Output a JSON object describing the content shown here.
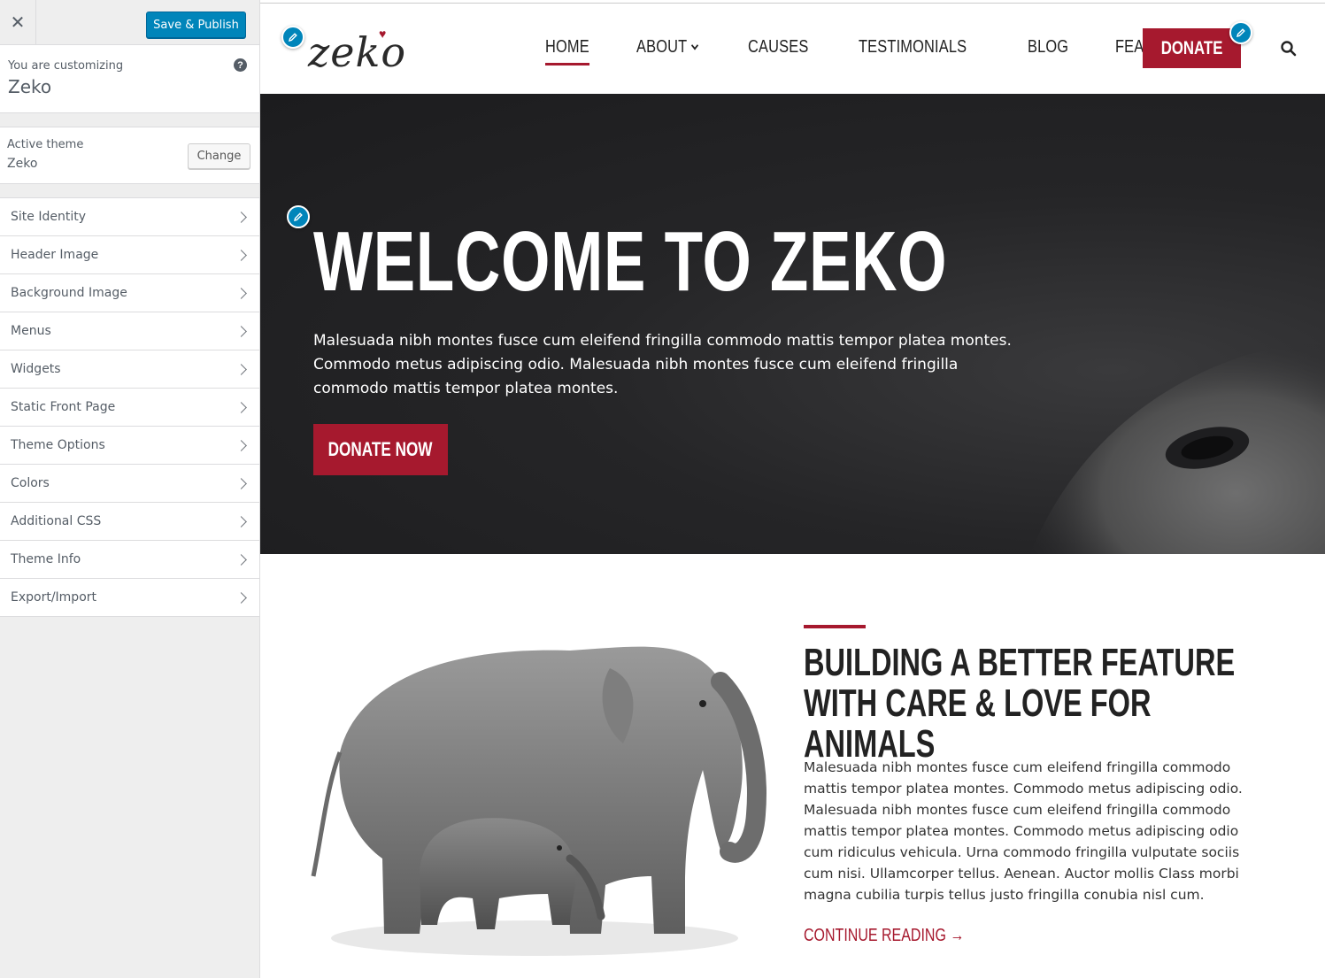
{
  "customizer": {
    "close_icon": "close-icon",
    "save_publish": "Save & Publish",
    "customizing_label": "You are customizing",
    "site_name": "Zeko",
    "help_icon": "?",
    "active_theme_label": "Active theme",
    "active_theme_name": "Zeko",
    "change_label": "Change",
    "items": [
      {
        "label": "Site Identity"
      },
      {
        "label": "Header Image"
      },
      {
        "label": "Background Image"
      },
      {
        "label": "Menus"
      },
      {
        "label": "Widgets"
      },
      {
        "label": "Static Front Page"
      },
      {
        "label": "Theme Options"
      },
      {
        "label": "Colors"
      },
      {
        "label": "Additional CSS"
      },
      {
        "label": "Theme Info"
      },
      {
        "label": "Export/Import"
      }
    ]
  },
  "site": {
    "logo": "zeko",
    "nav": [
      {
        "label": "HOME",
        "active": true
      },
      {
        "label": "ABOUT",
        "dropdown": true
      },
      {
        "label": "CAUSES"
      },
      {
        "label": "TESTIMONIALS"
      },
      {
        "label": "BLOG"
      },
      {
        "label": "FEATURES",
        "dropdown": true
      }
    ],
    "donate": "DONATE",
    "hero": {
      "title": "WELCOME TO ZEKO",
      "text": "Malesuada nibh montes fusce cum eleifend fringilla commodo mattis tempor platea montes. Commodo metus adipiscing odio. Malesuada nibh montes fusce cum eleifend fringilla commodo mattis tempor platea montes.",
      "button": "DONATE NOW"
    },
    "feature": {
      "title": "BUILDING A BETTER FEATURE WITH CARE & LOVE FOR ANIMALS",
      "text": "Malesuada nibh montes fusce cum eleifend fringilla commodo mattis tempor platea montes. Commodo metus adipiscing odio. Malesuada nibh montes fusce cum eleifend fringilla commodo mattis tempor platea montes. Commodo metus adipiscing odio cum ridiculus vehicula. Urna commodo fringilla vulputate sociis cum nisi. Ullamcorper tellus. Aenean. Auctor mollis Class morbi magna cubilia turpis tellus justo fringilla conubia nisl cum.",
      "link": "CONTINUE READING →"
    }
  },
  "colors": {
    "accent": "#a6192e",
    "wp_blue": "#0085ba",
    "hero_bg": "#1c1c1e"
  }
}
